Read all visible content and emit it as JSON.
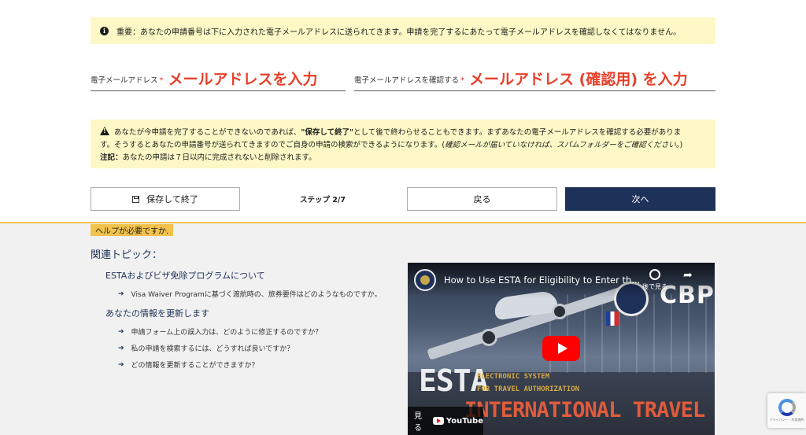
{
  "notice_top": {
    "icon": "info-icon",
    "text": "重要：あなたの申請番号は下に入力された電子メールアドレスに送られてきます。申請を完了するにあたって電子メールアドレスを確認しなくてはなりません。"
  },
  "email_field": {
    "label": "電子メールアドレス",
    "required_mark": "*",
    "value": "メールアドレスを入力"
  },
  "confirm_field": {
    "label": "電子メールアドレスを確認する",
    "required_mark": "*",
    "value": "メールアドレス (確認用) を入力"
  },
  "notice_mid": {
    "icon": "warning-icon",
    "part1": "あなたが今申請を完了することができないのであれば、",
    "bold_save": "\"保存して終了\"",
    "part2": "として後で終わらせることもできます。まずあなたの電子メールアドレスを確認する必要がありま",
    "part3": "す。そうするとあなたの申請番号が送られてきますのでご自身の申請の検索ができるようになります。(",
    "italic_note": "確認メールが届いていなければ、スパムフォルダーをご確認ください。",
    "part4": ")",
    "note_label": "注記：",
    "note_text": "あなたの申請は７日以内に完成されないと削除されます。"
  },
  "actions": {
    "save_label": "保存して終了",
    "step_label": "ステップ 2/7",
    "back_label": "戻る",
    "next_label": "次へ"
  },
  "help": {
    "tag": "ヘルプが必要ですか.",
    "related_title": "関連トピック：",
    "topics": [
      {
        "title": "ESTAおよびビザ免除プログラムについて",
        "links": [
          "Visa Waiver Programに基づく渡航時の、旅券要件はどのようなものですか。"
        ]
      },
      {
        "title": "あなたの情報を更新します",
        "links": [
          "申請フォーム上の誤入力は、どのように修正するのですか？",
          "私の申請を検索するには、どうすれば良いですか？",
          "どの情報を更新することができますか？"
        ]
      }
    ]
  },
  "video": {
    "title": "How to Use ESTA for Eligibility to Enter th...",
    "watch_later": "後で見る",
    "cbp": "CBP",
    "esta": "ESTA",
    "sub1": "ELECTRONIC SYSTEM",
    "sub2": "FOR TRAVEL AUTHORIZATION",
    "intl": "INTERNATIONAL TRAVEL",
    "watch_on": "見る",
    "youtube": "YouTube"
  },
  "recaptcha": {
    "text": "プライバシー・利用規約"
  },
  "colors": {
    "notice_bg": "#fdf8c6",
    "accent_red": "#e8402b",
    "navy": "#1e3158",
    "help_tag": "#f2c24c",
    "help_bg": "#f1f1f1"
  }
}
